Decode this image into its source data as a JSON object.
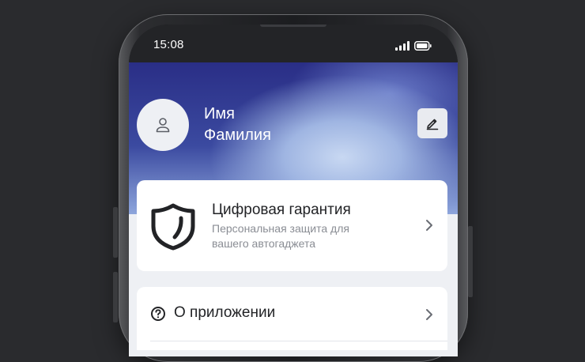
{
  "status_bar": {
    "time": "15:08",
    "icons": [
      "signal-icon",
      "battery-icon"
    ]
  },
  "profile": {
    "first_name": "Имя",
    "last_name": "Фамилия",
    "avatar_icon": "user-icon",
    "edit_icon": "pencil-icon"
  },
  "guarantee_card": {
    "title": "Цифровая гарантия",
    "subtitle": "Персональная защита для вашего автогаджета",
    "icon": "shield-icon",
    "chevron_icon": "chevron-right-icon"
  },
  "menu": {
    "about_label": "О приложении",
    "about_icon": "question-circle-icon",
    "chevron_icon": "chevron-right-icon"
  },
  "colors": {
    "background": "#2a2b2e",
    "hero_dark": "#2a2e86",
    "hero_light": "#c8d8f2",
    "app_background": "#eef0f4",
    "card": "#ffffff",
    "text_primary": "#222326",
    "text_secondary": "#8a8d94"
  }
}
